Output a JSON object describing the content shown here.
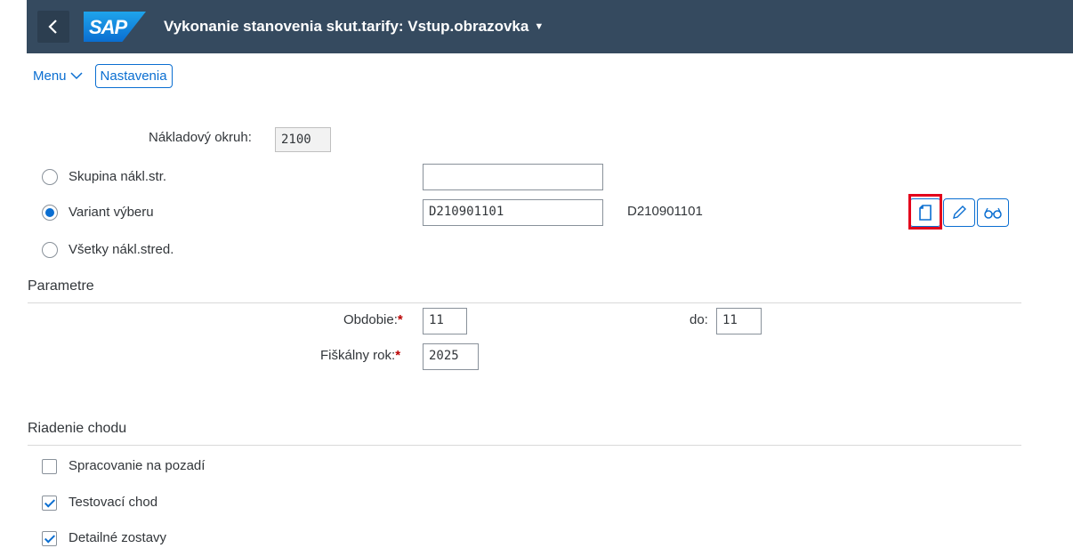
{
  "shell": {
    "title": "Vykonanie stanovenia skut.tarify: Vstup.obrazovka",
    "logo_text": "SAP"
  },
  "toolbar": {
    "menu_label": "Menu",
    "settings_label": "Nastavenia"
  },
  "form": {
    "cost_area_label": "Nákladový okruh:",
    "cost_area_value": "2100",
    "radios": [
      {
        "label": "Skupina nákl.str.",
        "selected": false,
        "value": ""
      },
      {
        "label": "Variant výberu",
        "selected": true,
        "value": "D210901101",
        "description": "D210901101"
      },
      {
        "label": "Všetky nákl.stred.",
        "selected": false
      }
    ]
  },
  "variant_actions": [
    "new-document-icon",
    "edit-pencil-icon",
    "display-glasses-icon"
  ],
  "parameters": {
    "title": "Parametre",
    "period_label": "Obdobie:",
    "period_value": "11",
    "to_label": "do:",
    "to_value": "11",
    "fiscal_year_label": "Fiškálny rok:",
    "fiscal_year_value": "2025"
  },
  "run_control": {
    "title": "Riadenie chodu",
    "options": [
      {
        "label": "Spracovanie na pozadí",
        "checked": false
      },
      {
        "label": "Testovací chod",
        "checked": true
      },
      {
        "label": "Detailné zostavy",
        "checked": true
      }
    ]
  },
  "colors": {
    "shell": "#354a5f",
    "accent": "#0a6ed1",
    "required": "#bb0000",
    "highlight": "#e3001b"
  }
}
